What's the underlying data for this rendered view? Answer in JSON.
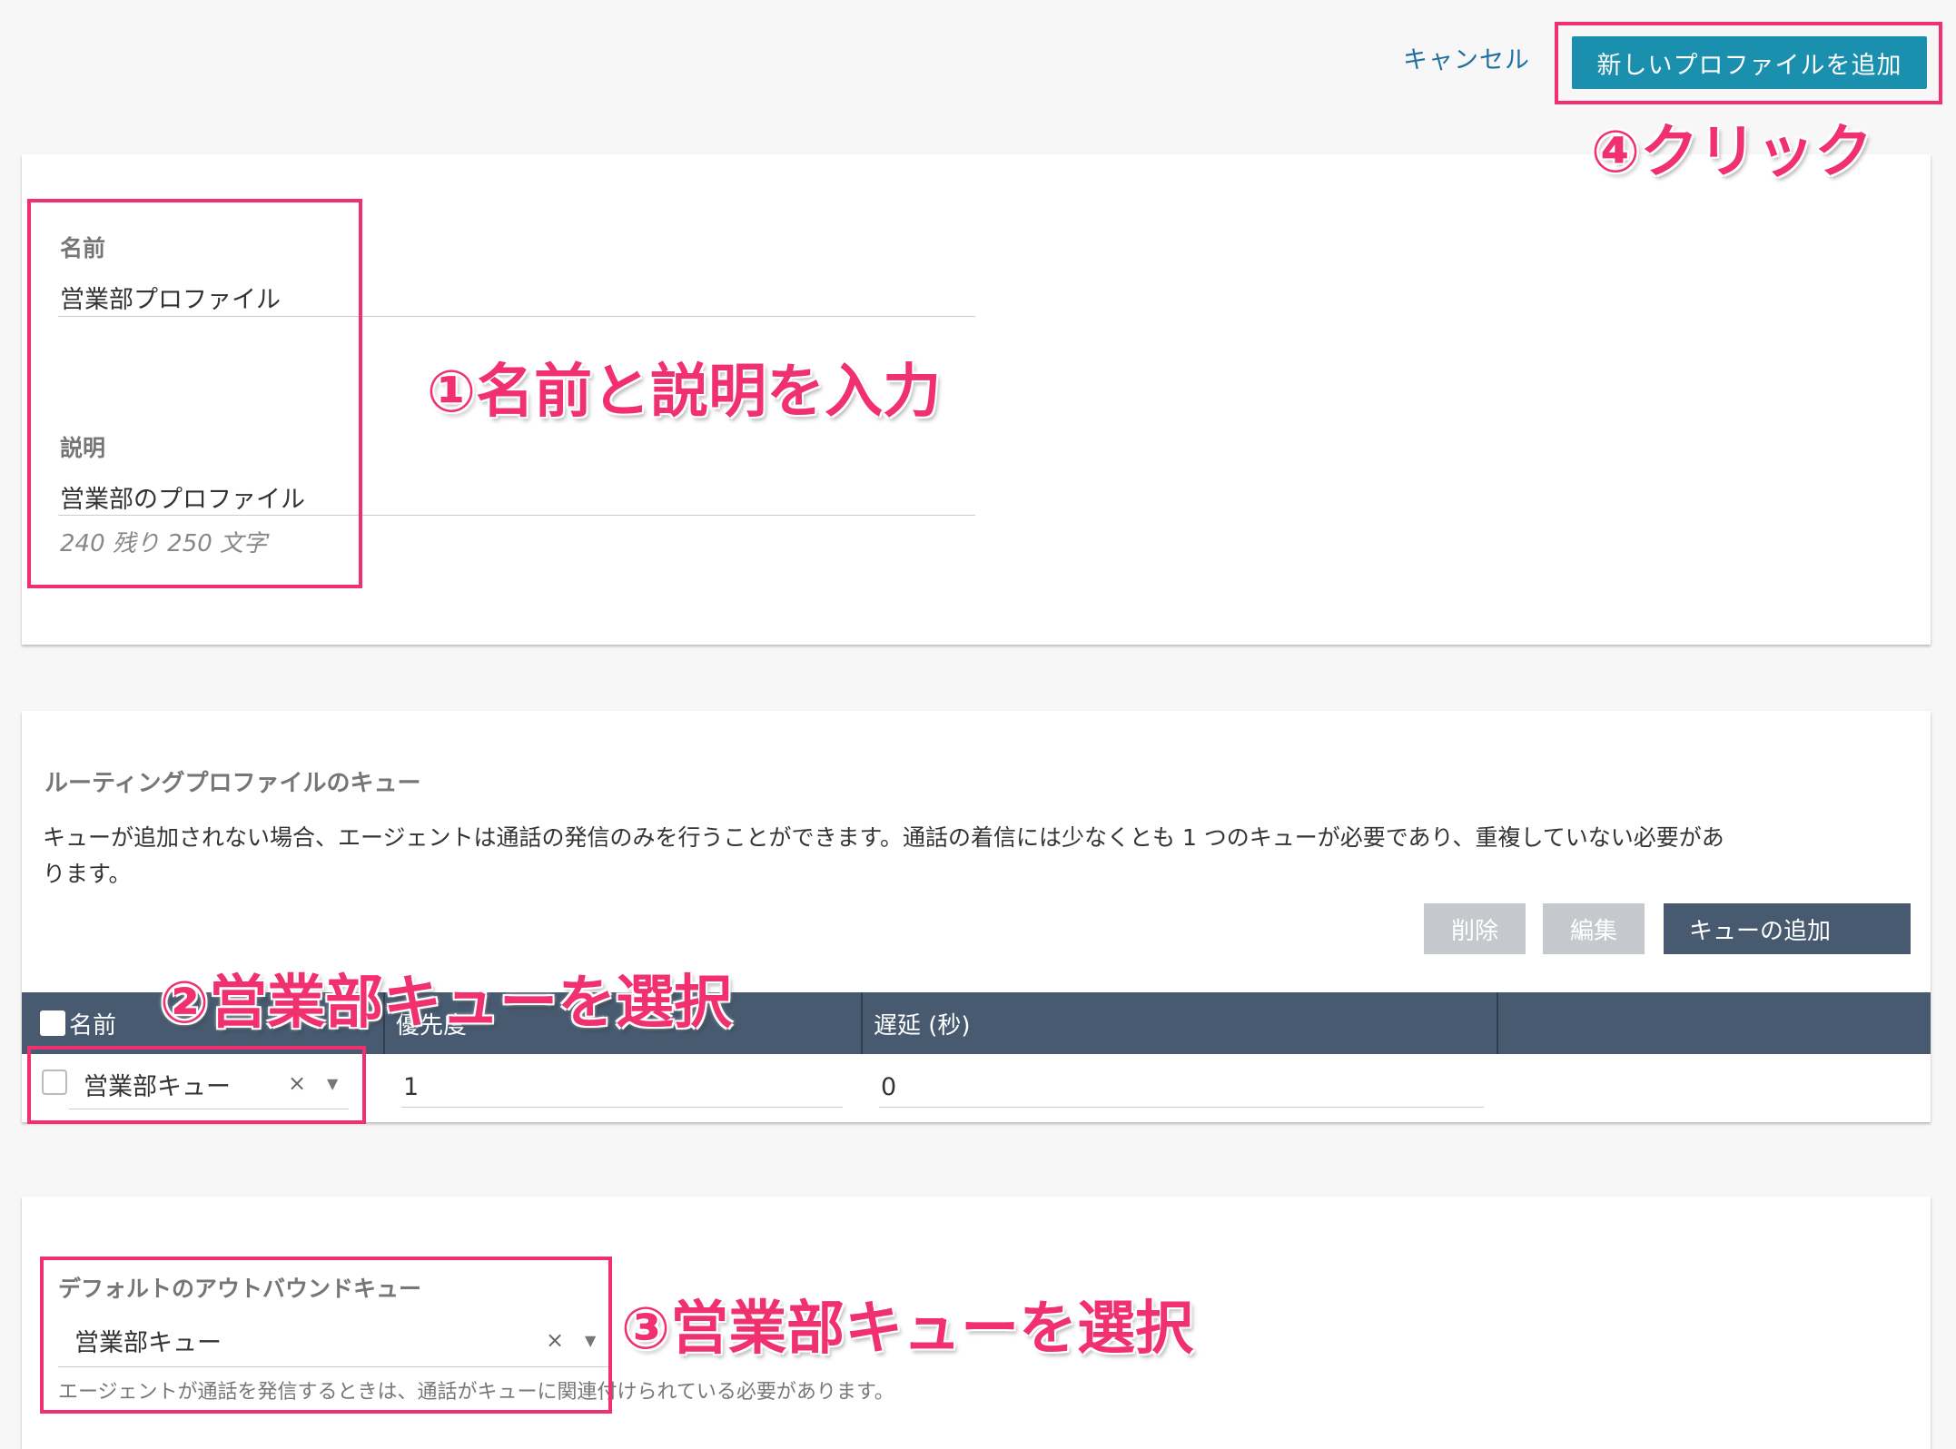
{
  "header": {
    "cancel_label": "キャンセル",
    "add_profile_label": "新しいプロファイルを追加"
  },
  "profile": {
    "name_label": "名前",
    "name_value": "営業部プロファイル",
    "description_label": "説明",
    "description_value": "営業部のプロファイル",
    "char_count": "240 残り 250 文字"
  },
  "queues": {
    "title": "ルーティングプロファイルのキュー",
    "description_line1": "キューが追加されない場合、エージェントは通話の発信のみを行うことができます。通話の着信には少なくとも 1 つのキューが必要であり、重複していない必要があ",
    "description_line2": "ります。",
    "delete_label": "削除",
    "edit_label": "編集",
    "add_queue_label": "キューの追加",
    "columns": [
      "名前",
      "優先度",
      "遅延 (秒)"
    ],
    "row": {
      "queue": "営業部キュー",
      "priority": "1",
      "delay": "0",
      "clear_icon": "×",
      "caret_icon": "▼"
    }
  },
  "default_outbound": {
    "label": "デフォルトのアウトバウンドキュー",
    "value": "営業部キュー",
    "help": "エージェントが通話を発信するときは、通話がキューに関連付けられている必要があります。",
    "clear_icon": "×",
    "caret_icon": "▼"
  },
  "annotations": {
    "step1": "①名前と説明を入力",
    "step2": "②営業部キューを選択",
    "step3": "③営業部キューを選択",
    "step4": "④クリック",
    "color": "#f0306f"
  },
  "colors": {
    "primary": "#1b8fae",
    "table_header": "#475a6f",
    "disabled_button": "#c5c9cd"
  }
}
